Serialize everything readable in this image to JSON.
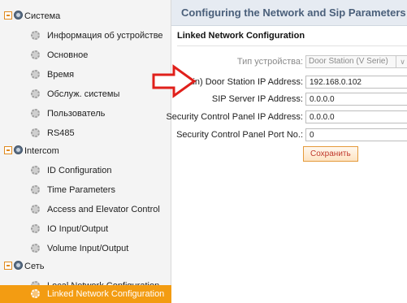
{
  "sidebar": {
    "groups": [
      {
        "label": "Система",
        "items": [
          "Информация об устройстве",
          "Основное",
          "Время",
          "Обслуж. системы",
          "Пользователь",
          "RS485"
        ]
      },
      {
        "label": "Intercom",
        "items": [
          "ID Configuration",
          "Time Parameters",
          "Access and Elevator Control",
          "IO Input/Output",
          "Volume Input/Output"
        ]
      },
      {
        "label": "Сеть",
        "items": [
          "Local Network Configuration",
          "Linked Network Configuration"
        ]
      }
    ],
    "active_item": "Linked Network Configuration"
  },
  "main": {
    "header_title": "Configuring the Network and Sip Parameters",
    "section_title": "Linked Network Configuration",
    "fields": {
      "device_type": {
        "label": "Тип устройства:",
        "value": "Door Station (V Serie)"
      },
      "main_door_station_ip": {
        "label": "(Main) Door Station IP Address:",
        "value": "192.168.0.102"
      },
      "sip_server_ip": {
        "label": "SIP Server IP Address:",
        "value": "0.0.0.0"
      },
      "security_panel_ip": {
        "label": "Security Control Panel IP Address:",
        "value": "0.0.0.0"
      },
      "security_panel_port": {
        "label": "Security Control Panel Port No.:",
        "value": "0"
      }
    },
    "save_label": "Сохранить"
  },
  "colors": {
    "accent": "#f39c12",
    "arrow_red": "#e0201b",
    "header_bg": "#e6ebf2",
    "header_text": "#4a5f7a"
  },
  "icons": {
    "group": "globe-icon",
    "item": "gear-icon",
    "collapse": "minus-box-icon",
    "annotation": "red-arrow"
  }
}
